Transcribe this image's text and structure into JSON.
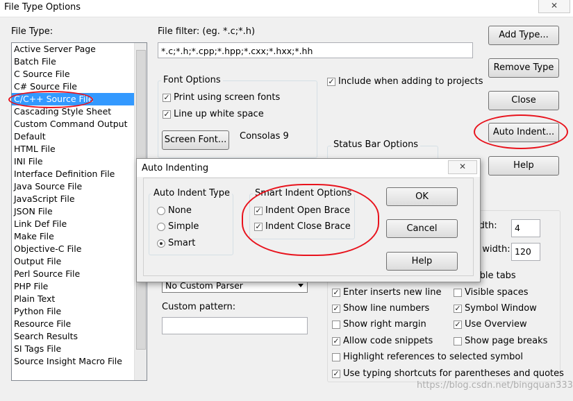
{
  "window": {
    "title": "File Type Options",
    "close": "✕"
  },
  "file_type": {
    "label": "File Type:",
    "items": [
      "Active Server Page",
      "Batch File",
      "C Source File",
      "C# Source File",
      "C/C++ Source File",
      "Cascading Style Sheet",
      "Custom Command Output",
      "Default",
      "HTML File",
      "INI File",
      "Interface Definition File",
      "Java Source File",
      "JavaScript File",
      "JSON File",
      "Link Def File",
      "Make File",
      "Objective-C File",
      "Output File",
      "Perl Source File",
      "PHP File",
      "Plain Text",
      "Python File",
      "Resource File",
      "Search Results",
      "SI Tags File",
      "Source Insight Macro File"
    ],
    "selected_index": 4
  },
  "file_filter": {
    "label": "File filter: (eg. *.c;*.h)",
    "value": "*.c;*.h;*.cpp;*.hpp;*.cxx;*.hxx;*.hh"
  },
  "font_options": {
    "label": "Font Options",
    "print_screen_fonts": "Print using screen fonts",
    "line_up_white_space": "Line up white space",
    "screen_font_button": "Screen Font...",
    "font_name": "Consolas 9"
  },
  "include_projects": "Include when adding to projects",
  "status_bar_options": {
    "label": "Status Bar Options"
  },
  "buttons": {
    "add_type": "Add Type...",
    "remove_type": "Remove Type",
    "close": "Close",
    "auto_indent": "Auto Indent...",
    "help": "Help"
  },
  "parser": {
    "value": "No Custom Parser",
    "custom_pattern_label": "Custom pattern:"
  },
  "width_fields": {
    "tab_width_label": "idth:",
    "tab_width_value": "4",
    "margin_width_label": "n width:",
    "margin_width_value": "120"
  },
  "editing_options": {
    "visible_tabs": "ible tabs",
    "enter_inserts_new_line": "Enter inserts new line",
    "visible_spaces": "Visible spaces",
    "show_line_numbers": "Show line numbers",
    "symbol_window": "Symbol Window",
    "show_right_margin": "Show right margin",
    "use_overview": "Use Overview",
    "allow_code_snippets": "Allow code snippets",
    "show_page_breaks": "Show page breaks",
    "highlight_references": "Highlight references to selected symbol",
    "typing_shortcuts": "Use typing shortcuts for parentheses and quotes"
  },
  "watermark": "https://blog.csdn.net/bingquan3333",
  "auto_indent_dialog": {
    "title": "Auto Indenting",
    "close": "✕",
    "type_label": "Auto Indent Type",
    "none": "None",
    "simple": "Simple",
    "smart": "Smart",
    "selected_type": "Smart",
    "smart_label": "Smart Indent Options",
    "indent_open_brace": "Indent Open Brace",
    "indent_close_brace": "Indent Close Brace",
    "ok": "OK",
    "cancel": "Cancel",
    "help": "Help"
  },
  "colors": {
    "selection": "#3399ff",
    "annotation": "#e8121c"
  }
}
